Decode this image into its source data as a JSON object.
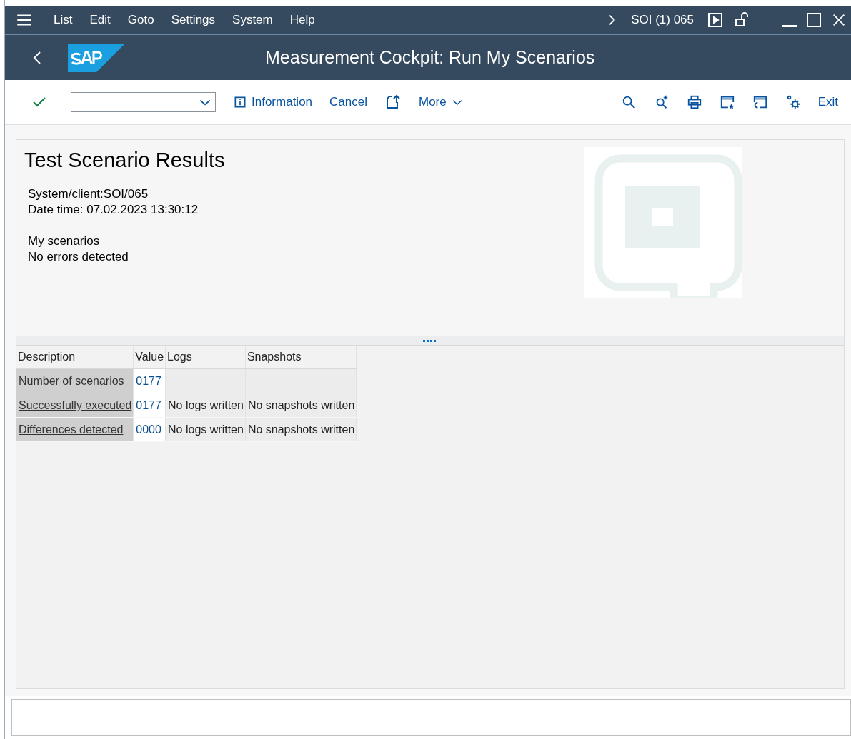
{
  "menu_bar": {
    "items": [
      {
        "label": "List"
      },
      {
        "label": "Edit"
      },
      {
        "label": "Goto"
      },
      {
        "label": "Settings"
      },
      {
        "label": "System"
      },
      {
        "label": "Help"
      }
    ],
    "session": "SOI (1) 065"
  },
  "title_bar": {
    "title": "Measurement Cockpit: Run My Scenarios"
  },
  "toolbar": {
    "buttons": [
      {
        "label": "Information"
      },
      {
        "label": "Cancel"
      }
    ],
    "more": "More",
    "exit": "Exit"
  },
  "report": {
    "heading": "Test Scenario Results",
    "lines": [
      "System/client:SOI/065",
      "Date time: 07.02.2023 13:30:12"
    ],
    "lines_2": [
      "My scenarios",
      "No errors detected"
    ],
    "logo": {
      "kind": "picture"
    }
  },
  "table": {
    "columns": [
      "Description",
      "Value",
      "Logs",
      "Snapshots"
    ],
    "rows": [
      {
        "description": "Number of scenarios",
        "value": "0177"
      },
      {
        "description": "Successfully executed",
        "value": "0177",
        "logs": "No logs written",
        "snapshots": "No snapshots written"
      },
      {
        "description": "Differences detected",
        "value": "0000",
        "logs": "No logs written",
        "snapshots": "No snapshots written"
      }
    ]
  }
}
